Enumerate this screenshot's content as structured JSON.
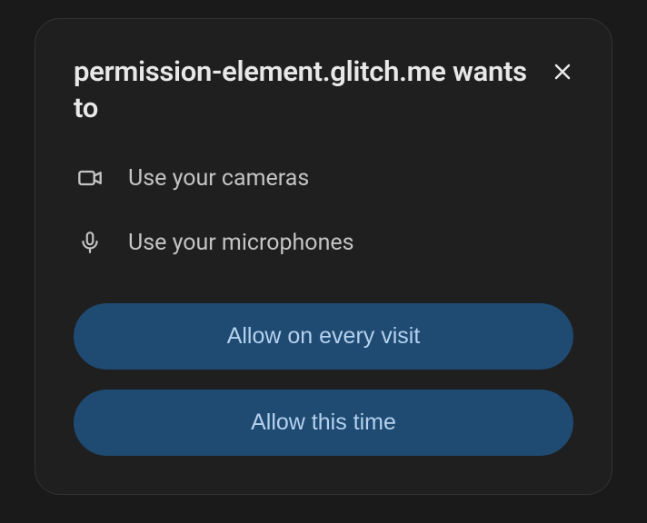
{
  "dialog": {
    "site": "permission-element.glitch.me",
    "title_suffix": "wants to"
  },
  "permissions": [
    {
      "icon": "camera",
      "label": "Use your cameras"
    },
    {
      "icon": "microphone",
      "label": "Use your microphones"
    }
  ],
  "buttons": {
    "allow_every": "Allow on every visit",
    "allow_once": "Allow this time"
  }
}
